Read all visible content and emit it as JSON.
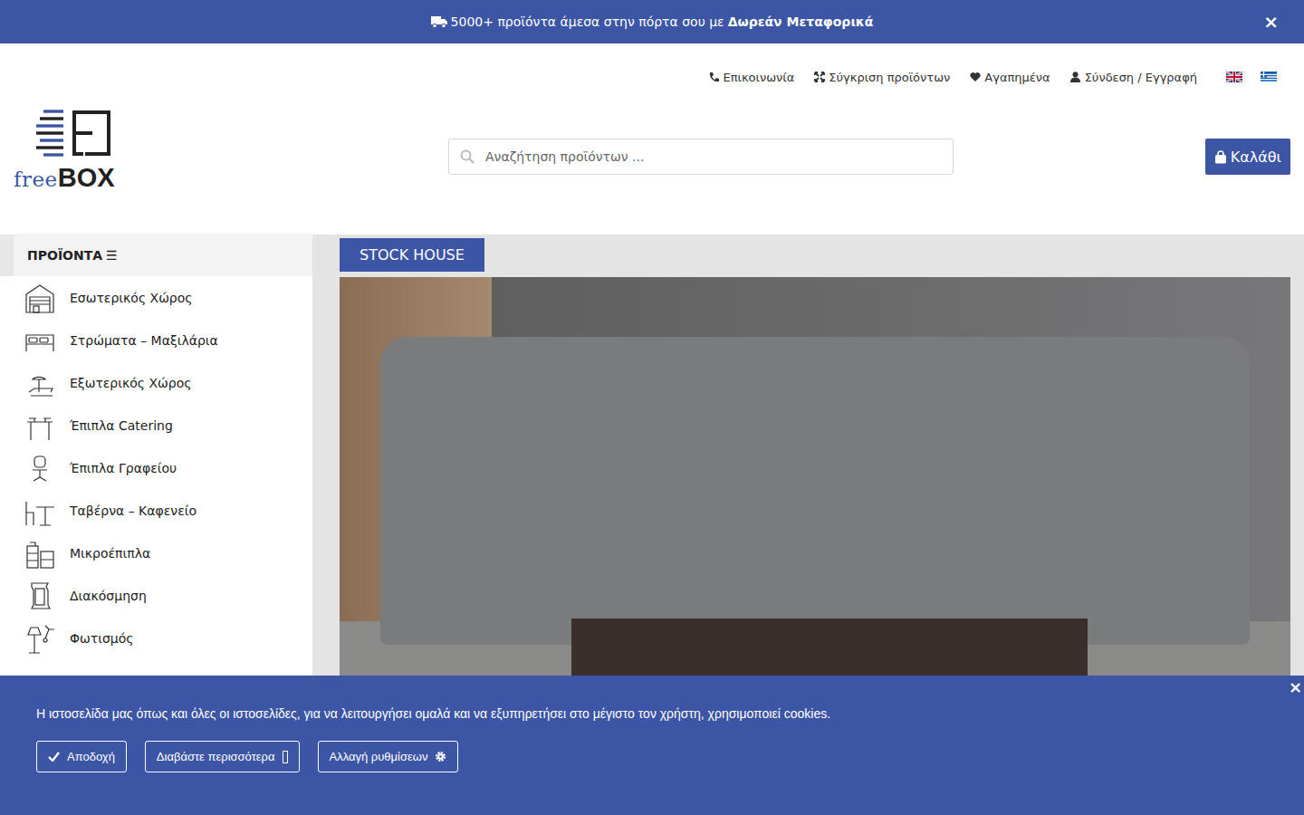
{
  "announcement": {
    "text": "5000+ προϊόντα άμεσα στην πόρτα σου με",
    "bold": "Δωρεάν Μεταφορικά",
    "close": "×"
  },
  "top_links": [
    {
      "label": "Επικοινωνία"
    },
    {
      "label": "Σύγκριση προϊόντων"
    },
    {
      "label": "Αγαπημένα"
    },
    {
      "label": "Σύνδεση / Εγγραφή"
    }
  ],
  "logo": {
    "light": "free",
    "bold": "BOX"
  },
  "search": {
    "placeholder": "Αναζήτηση προϊόντων ..."
  },
  "cart": {
    "label": "Καλάθι"
  },
  "sidebar": {
    "title": "ΠΡΟΪΟΝΤΑ",
    "menu_icon": "☰",
    "items": [
      {
        "label": "Εσωτερικός Χώρος"
      },
      {
        "label": "Στρώματα – Μαξιλάρια"
      },
      {
        "label": "Εξωτερικός Χώρος"
      },
      {
        "label": "Έπιπλα Catering"
      },
      {
        "label": "Έπιπλα Γραφείου"
      },
      {
        "label": "Ταβέρνα – Καφενείο"
      },
      {
        "label": "Μικροέπιπλα"
      },
      {
        "label": "Διακόσμηση"
      },
      {
        "label": "Φωτισμός"
      }
    ]
  },
  "banner": {
    "tab": "STOCK HOUSE"
  },
  "cookie": {
    "text": "Η ιστοσελίδα μας όπως και όλες οι ιστοσελίδες, για να λειτουργήσει ομαλά και να εξυπηρετήσει στο μέγιστο τον χρήστη, χρησιμοποιεί cookies.",
    "close": "×",
    "buttons": [
      {
        "label": "Αποδοχή",
        "kind": "accept"
      },
      {
        "label": "Διαβάστε περισσότερα",
        "kind": "more"
      },
      {
        "label": "Αλλαγή ρυθμίσεων",
        "kind": "settings"
      }
    ]
  }
}
